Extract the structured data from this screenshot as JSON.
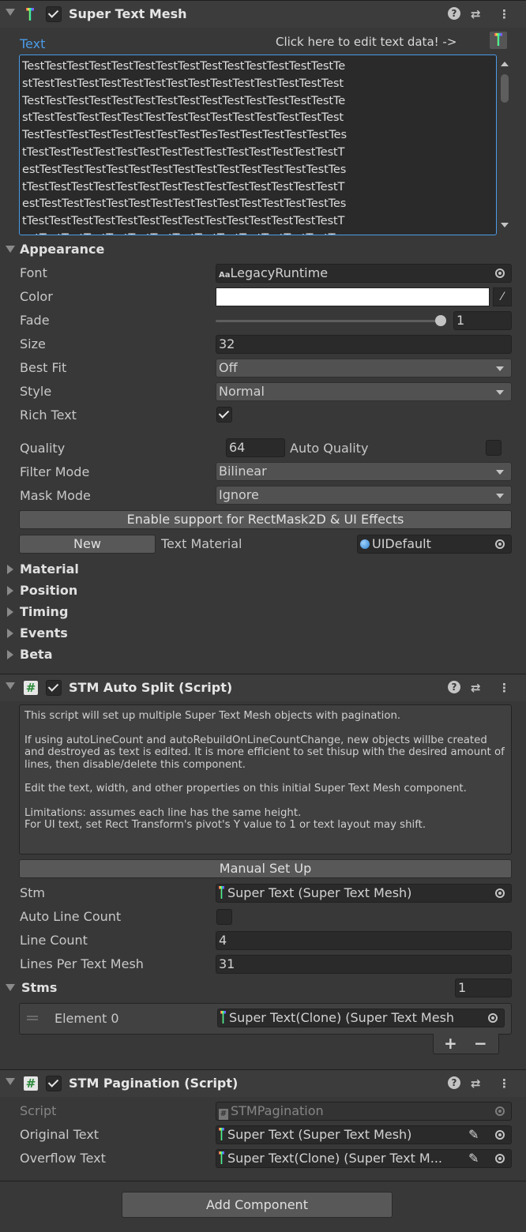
{
  "stm": {
    "title": "Super Text Mesh",
    "text_label": "Text",
    "edit_hint": "Click here to edit text data! ->",
    "text_lines": [
      "TestTestTestTestTestTestTestTestTestTestTestTestTestTestTe",
      "stTestTestTestTestTestTestTestTestTestTestTestTestTestTest",
      "TestTestTestTestTestTestTestTestTestTestTestTestTestTestTe",
      "stTestTestTestTestTestTestTestTestTestTestTestTestTestTest",
      "TestTestTestTestTestTestTestTestTesTestTestTestTestTestTes",
      "tTestTestTestTestTestTestTestTestTestTestTestTestTestTestT",
      "estTestTestTestTestTestTestTestTestTestTestTestTestTestTes",
      "tTestTestTestTestTestTestTestTestTestTestTestTestTestTestT",
      "estTestTestTestTestTestTestTestTestTestTestTestTestTestTes",
      "tTestTestTestTestTestTestTestTestTestTestTestTestTestTestT",
      "estTestTestTestTestTestTestTestTestTestTestTestTestTestTes"
    ],
    "appearance_label": "Appearance",
    "font_label": "Font",
    "font_value": "LegacyRuntime",
    "font_icon": "Aa",
    "color_label": "Color",
    "color_value": "#ffffff",
    "fade_label": "Fade",
    "fade_value": "1",
    "fade_fraction": 1.0,
    "size_label": "Size",
    "size_value": "32",
    "bestfit_label": "Best Fit",
    "bestfit_value": "Off",
    "style_label": "Style",
    "style_value": "Normal",
    "richtext_label": "Rich Text",
    "quality_label": "Quality",
    "quality_value": "64",
    "autoquality_label": "Auto Quality",
    "filter_label": "Filter Mode",
    "filter_value": "Bilinear",
    "mask_label": "Mask Mode",
    "mask_value": "Ignore",
    "enable_button": "Enable support for RectMask2D & UI Effects",
    "new_button": "New",
    "textmat_label": "Text Material",
    "textmat_value": "UIDefault",
    "sections": [
      "Material",
      "Position",
      "Timing",
      "Events",
      "Beta"
    ]
  },
  "autosplit": {
    "title": "STM Auto Split (Script)",
    "help": [
      "This script will set up multiple Super Text Mesh objects with pagination.",
      "If using autoLineCount and autoRebuildOnLineCountChange, new objects willbe created and destroyed as text is edited. It is more efficient to set thisup with the desired amount of lines, then disable/delete this component.",
      "Edit the text, width, and other properties on this initial Super Text Mesh component.",
      "Limitations: assumes each line has the same height.",
      "For UI text, set Rect Transform's pivot's Y value to 1 or text layout may shift."
    ],
    "manual_button": "Manual Set Up",
    "stm_label": "Stm",
    "stm_value": "Super Text (Super Text Mesh)",
    "autoline_label": "Auto Line Count",
    "linecount_label": "Line Count",
    "linecount_value": "4",
    "lpt_label": "Lines Per Text Mesh",
    "lpt_value": "31",
    "stms_label": "Stms",
    "stms_count": "1",
    "element_label": "Element 0",
    "element_value": "Super Text(Clone) (Super Text Mesh",
    "plus": "+",
    "minus": "−"
  },
  "pagination": {
    "title": "STM Pagination (Script)",
    "script_label": "Script",
    "script_value": "STMPagination",
    "original_label": "Original Text",
    "original_value": "Super Text (Super Text Mesh)",
    "overflow_label": "Overflow Text",
    "overflow_value": "Super Text(Clone) (Super Text M..."
  },
  "add_component": "Add Component",
  "colors": {
    "accent": "#4b9ce8",
    "panel": "#383838",
    "field": "#2a2a2a"
  }
}
